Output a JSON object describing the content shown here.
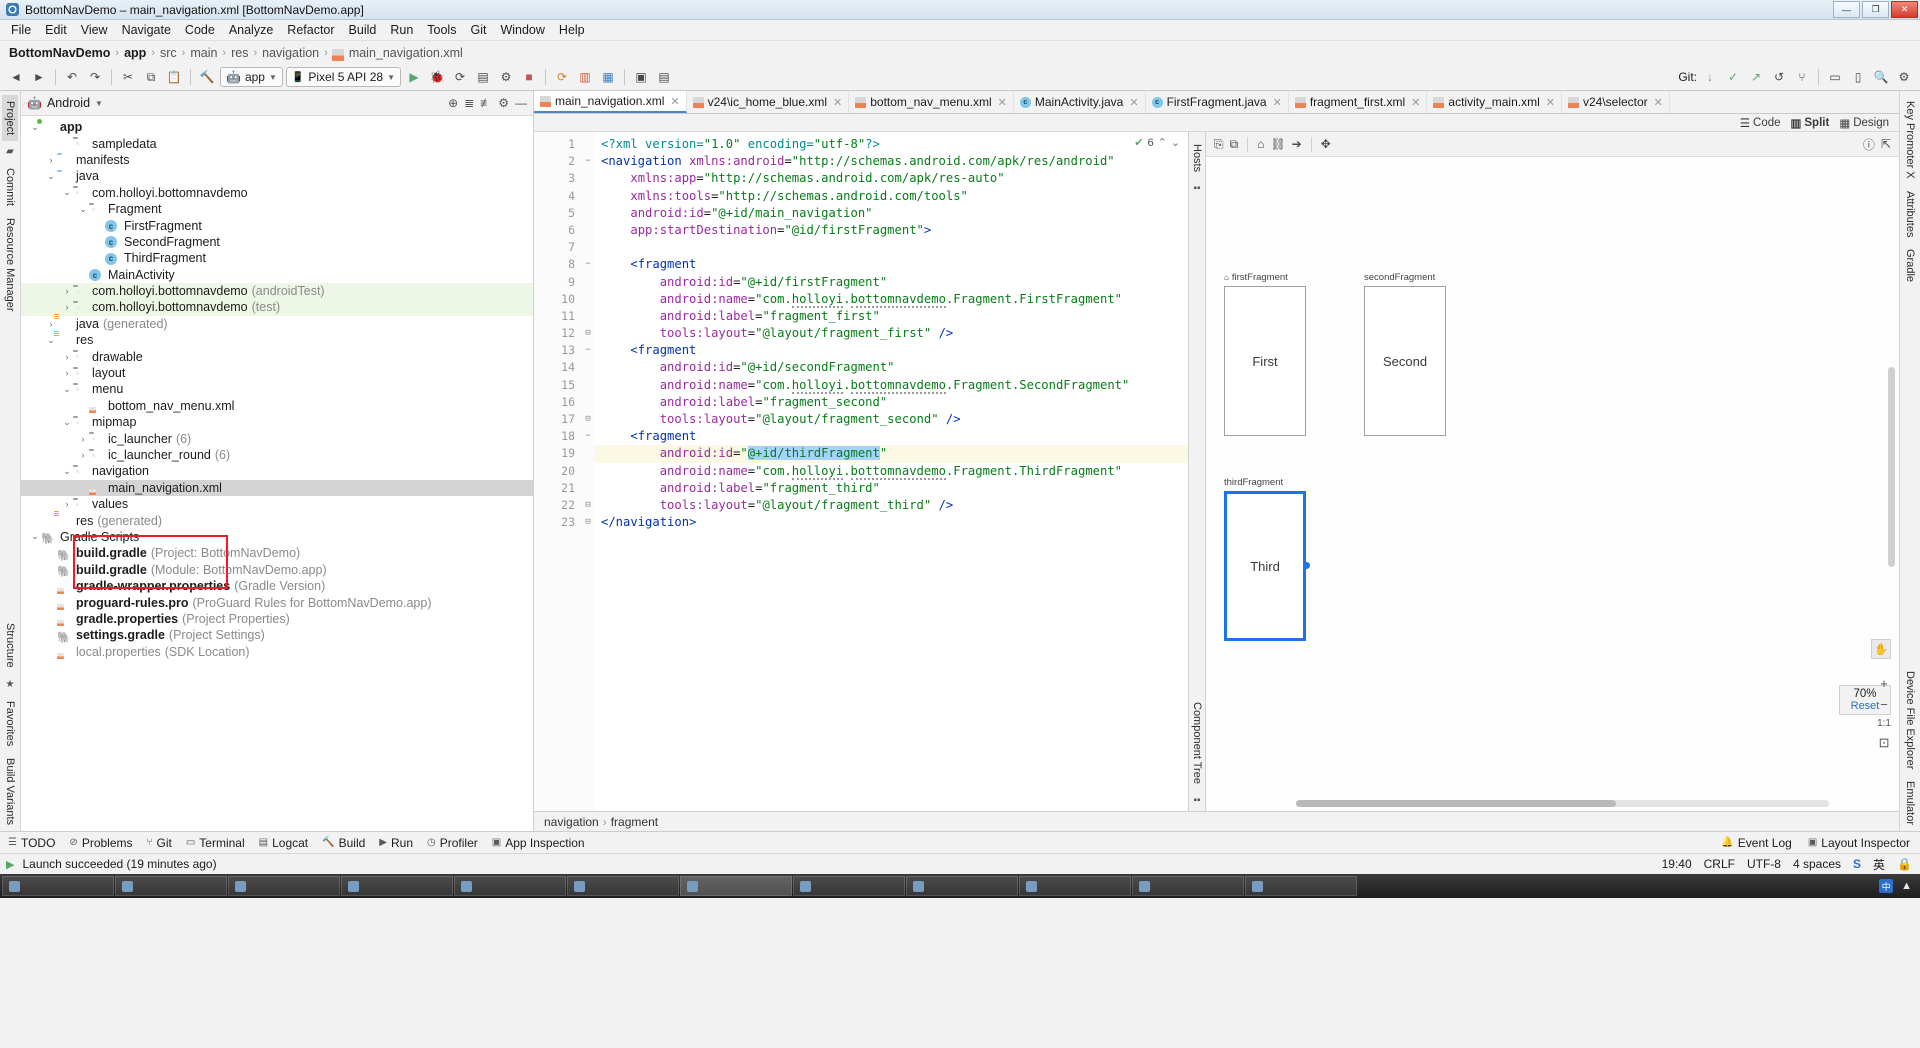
{
  "titlebar": {
    "title": "BottomNavDemo – main_navigation.xml [BottomNavDemo.app]",
    "app_initial": "AS",
    "minimize": "—",
    "maximize": "❐",
    "close": "✕"
  },
  "menubar": {
    "items": [
      "File",
      "Edit",
      "View",
      "Navigate",
      "Code",
      "Analyze",
      "Refactor",
      "Build",
      "Run",
      "Tools",
      "Git",
      "Window",
      "Help"
    ]
  },
  "breadcrumb": {
    "items": [
      "BottomNavDemo",
      "app",
      "src",
      "main",
      "res",
      "navigation",
      "main_navigation.xml"
    ]
  },
  "toolbar": {
    "run_config": "app",
    "device": "Pixel 5 API 28",
    "git_label": "Git:",
    "icons": [
      "hammer-icon",
      "sync-icon",
      "run-icon",
      "debug-icon",
      "profile-icon",
      "stop-icon",
      "avd-icon",
      "sdk-icon",
      "layout-inspector-icon",
      "search-icon",
      "settings-icon"
    ]
  },
  "project": {
    "header_label": "Android",
    "tree": [
      {
        "depth": 0,
        "arrow": "v",
        "icon": "f-mod",
        "label": "app",
        "bold": true,
        "suffix": ""
      },
      {
        "depth": 2,
        "arrow": "",
        "icon": "f-gray",
        "label": "sampledata",
        "bold": false,
        "suffix": ""
      },
      {
        "depth": 1,
        "arrow": ">",
        "icon": "f-blue",
        "label": "manifests",
        "bold": false,
        "suffix": ""
      },
      {
        "depth": 1,
        "arrow": "v",
        "icon": "f-blue",
        "label": "java",
        "bold": false,
        "suffix": ""
      },
      {
        "depth": 2,
        "arrow": "v",
        "icon": "f-gray",
        "label": "com.holloyi.bottomnavdemo",
        "bold": false,
        "suffix": ""
      },
      {
        "depth": 3,
        "arrow": "v",
        "icon": "f-gray",
        "label": "Fragment",
        "bold": false,
        "suffix": ""
      },
      {
        "depth": 4,
        "arrow": "",
        "icon": "c-cls",
        "label": "FirstFragment",
        "bold": false,
        "suffix": ""
      },
      {
        "depth": 4,
        "arrow": "",
        "icon": "c-cls",
        "label": "SecondFragment",
        "bold": false,
        "suffix": ""
      },
      {
        "depth": 4,
        "arrow": "",
        "icon": "c-cls",
        "label": "ThirdFragment",
        "bold": false,
        "suffix": ""
      },
      {
        "depth": 3,
        "arrow": "",
        "icon": "c-cls",
        "label": "MainActivity",
        "bold": false,
        "suffix": ""
      },
      {
        "depth": 2,
        "arrow": ">",
        "icon": "f-gray",
        "label": "com.holloyi.bottomnavdemo",
        "bold": false,
        "suffix": "(androidTest)",
        "row": "test"
      },
      {
        "depth": 2,
        "arrow": ">",
        "icon": "f-gray",
        "label": "com.holloyi.bottomnavdemo",
        "bold": false,
        "suffix": "(test)",
        "row": "test"
      },
      {
        "depth": 1,
        "arrow": ">",
        "icon": "f-res",
        "label": "java",
        "bold": false,
        "suffix": "(generated)"
      },
      {
        "depth": 1,
        "arrow": "v",
        "icon": "f-res",
        "label": "res",
        "bold": false,
        "suffix": ""
      },
      {
        "depth": 2,
        "arrow": ">",
        "icon": "f-gray",
        "label": "drawable",
        "bold": false,
        "suffix": ""
      },
      {
        "depth": 2,
        "arrow": ">",
        "icon": "f-gray",
        "label": "layout",
        "bold": false,
        "suffix": ""
      },
      {
        "depth": 2,
        "arrow": "v",
        "icon": "f-gray",
        "label": "menu",
        "bold": false,
        "suffix": ""
      },
      {
        "depth": 3,
        "arrow": "",
        "icon": "x-xml",
        "label": "bottom_nav_menu.xml",
        "bold": false,
        "suffix": ""
      },
      {
        "depth": 2,
        "arrow": "v",
        "icon": "f-gray",
        "label": "mipmap",
        "bold": false,
        "suffix": ""
      },
      {
        "depth": 3,
        "arrow": ">",
        "icon": "f-gray",
        "label": "ic_launcher",
        "bold": false,
        "suffix": "(6)"
      },
      {
        "depth": 3,
        "arrow": ">",
        "icon": "f-gray",
        "label": "ic_launcher_round",
        "bold": false,
        "suffix": "(6)"
      },
      {
        "depth": 2,
        "arrow": "v",
        "icon": "f-gray",
        "label": "navigation",
        "bold": false,
        "suffix": ""
      },
      {
        "depth": 3,
        "arrow": "",
        "icon": "x-xml",
        "label": "main_navigation.xml",
        "bold": false,
        "suffix": "",
        "row": "sel"
      },
      {
        "depth": 2,
        "arrow": ">",
        "icon": "f-gray",
        "label": "values",
        "bold": false,
        "suffix": ""
      },
      {
        "depth": 1,
        "arrow": "",
        "icon": "f-res",
        "label": "res",
        "bold": false,
        "suffix": "(generated)"
      },
      {
        "depth": 0,
        "arrow": "v",
        "icon": "g-grd",
        "label": "Gradle Scripts",
        "bold": false,
        "suffix": ""
      },
      {
        "depth": 1,
        "arrow": "",
        "icon": "g-grd",
        "label": "build.gradle",
        "bold": true,
        "suffix": "(Project: BottomNavDemo)"
      },
      {
        "depth": 1,
        "arrow": "",
        "icon": "g-grd",
        "label": "build.gradle",
        "bold": true,
        "suffix": "(Module: BottomNavDemo.app)"
      },
      {
        "depth": 1,
        "arrow": "",
        "icon": "x-xml",
        "label": "gradle-wrapper.properties",
        "bold": true,
        "suffix": "(Gradle Version)"
      },
      {
        "depth": 1,
        "arrow": "",
        "icon": "x-xml",
        "label": "proguard-rules.pro",
        "bold": true,
        "suffix": "(ProGuard Rules for BottomNavDemo.app)"
      },
      {
        "depth": 1,
        "arrow": "",
        "icon": "x-xml",
        "label": "gradle.properties",
        "bold": true,
        "suffix": "(Project Properties)"
      },
      {
        "depth": 1,
        "arrow": "",
        "icon": "g-grd",
        "label": "settings.gradle",
        "bold": true,
        "suffix": "(Project Settings)"
      },
      {
        "depth": 1,
        "arrow": "",
        "icon": "x-xml",
        "label": "local.properties",
        "bold": false,
        "suffix": "(SDK Location)",
        "dim": true
      }
    ]
  },
  "left_rail": {
    "tabs": [
      "Project",
      "Commit",
      "Resource Manager"
    ]
  },
  "right_rail": {
    "tabs": [
      "Key Promoter X",
      "Attributes",
      "Gradle",
      "Device File Explorer",
      "Emulator"
    ]
  },
  "bottom_rail": {
    "tabs": [
      "Structure",
      "Favorites",
      "Build Variants"
    ]
  },
  "editor_tabs": [
    {
      "label": "main_navigation.xml",
      "icon": "xml-icon",
      "active": true
    },
    {
      "label": "v24\\ic_home_blue.xml",
      "icon": "xml-icon",
      "active": false
    },
    {
      "label": "bottom_nav_menu.xml",
      "icon": "xml-icon",
      "active": false
    },
    {
      "label": "MainActivity.java",
      "icon": "java-icon",
      "active": false
    },
    {
      "label": "FirstFragment.java",
      "icon": "java-icon",
      "active": false
    },
    {
      "label": "fragment_first.xml",
      "icon": "xml-icon",
      "active": false
    },
    {
      "label": "activity_main.xml",
      "icon": "xml-icon",
      "active": false
    },
    {
      "label": "v24\\selector",
      "icon": "xml-icon",
      "active": false
    }
  ],
  "mode_bar": {
    "code": "Code",
    "split": "Split",
    "design": "Design"
  },
  "code": {
    "inspection_count": "6",
    "lines": [
      {
        "n": 1,
        "fold": "",
        "html": "<span class=\"pi\">&lt;?xml version=</span><span class=\"v\">\"1.0\"</span><span class=\"pi\"> encoding=</span><span class=\"v\">\"utf-8\"</span><span class=\"pi\">?&gt;</span>"
      },
      {
        "n": 2,
        "fold": "−",
        "html": "<span class=\"k\">&lt;navigation </span><span class=\"at\">xmlns:android</span><span class=\"eq\">=</span><span class=\"v\">\"http://schemas.android.com/apk/res/android\"</span>"
      },
      {
        "n": 3,
        "fold": "",
        "html": "    <span class=\"at\">xmlns:app</span><span class=\"eq\">=</span><span class=\"v\">\"http://schemas.android.com/apk/res-auto\"</span>"
      },
      {
        "n": 4,
        "fold": "",
        "html": "    <span class=\"at\">xmlns:tools</span><span class=\"eq\">=</span><span class=\"v\">\"http://schemas.android.com/tools\"</span>"
      },
      {
        "n": 5,
        "fold": "",
        "html": "    <span class=\"at\">android:id</span><span class=\"eq\">=</span><span class=\"v\">\"@+id/main_navigation\"</span>"
      },
      {
        "n": 6,
        "fold": "",
        "html": "    <span class=\"at\">app:startDestination</span><span class=\"eq\">=</span><span class=\"v\">\"@id/firstFragment\"</span><span class=\"k\">&gt;</span>"
      },
      {
        "n": 7,
        "fold": "",
        "html": ""
      },
      {
        "n": 8,
        "fold": "−",
        "html": "    <span class=\"k\">&lt;fragment</span>"
      },
      {
        "n": 9,
        "fold": "",
        "html": "        <span class=\"at\">android:id</span><span class=\"eq\">=</span><span class=\"v\">\"@+id/firstFragment\"</span>"
      },
      {
        "n": 10,
        "fold": "",
        "html": "        <span class=\"at\">android:name</span><span class=\"eq\">=</span><span class=\"v\">\"com.<span class=\"squig\">holloyi</span>.<span class=\"squig\">bottomnavdemo</span>.Fragment.FirstFragment\"</span>"
      },
      {
        "n": 11,
        "fold": "",
        "html": "        <span class=\"at\">android:label</span><span class=\"eq\">=</span><span class=\"v\">\"fragment_first\"</span>"
      },
      {
        "n": 12,
        "fold": "⊟",
        "html": "        <span class=\"at\">tools:layout</span><span class=\"eq\">=</span><span class=\"v\">\"@layout/fragment_first\"</span> <span class=\"k\">/&gt;</span>"
      },
      {
        "n": 13,
        "fold": "−",
        "html": "    <span class=\"k\">&lt;fragment</span>"
      },
      {
        "n": 14,
        "fold": "",
        "html": "        <span class=\"at\">android:id</span><span class=\"eq\">=</span><span class=\"v\">\"@+id/secondFragment\"</span>"
      },
      {
        "n": 15,
        "fold": "",
        "html": "        <span class=\"at\">android:name</span><span class=\"eq\">=</span><span class=\"v\">\"com.<span class=\"squig\">holloyi</span>.<span class=\"squig\">bottomnavdemo</span>.Fragment.SecondFragment\"</span>"
      },
      {
        "n": 16,
        "fold": "",
        "html": "        <span class=\"at\">android:label</span><span class=\"eq\">=</span><span class=\"v\">\"fragment_second\"</span>"
      },
      {
        "n": 17,
        "fold": "⊟",
        "html": "        <span class=\"at\">tools:layout</span><span class=\"eq\">=</span><span class=\"v\">\"@layout/fragment_second\"</span> <span class=\"k\">/&gt;</span>"
      },
      {
        "n": 18,
        "fold": "−",
        "html": "    <span class=\"k\">&lt;fragment</span>"
      },
      {
        "n": 19,
        "fold": "",
        "hl": true,
        "html": "        <span class=\"at\">android:id</span><span class=\"eq\">=</span><span class=\"v\">\"<span class=\"sel-txt\">@+id/thirdFragment</span>\"</span>"
      },
      {
        "n": 20,
        "fold": "",
        "html": "        <span class=\"at\">android:name</span><span class=\"eq\">=</span><span class=\"v\">\"com.<span class=\"squig\">holloyi</span>.<span class=\"squig\">bottomnavdemo</span>.Fragment.ThirdFragment\"</span>"
      },
      {
        "n": 21,
        "fold": "",
        "html": "        <span class=\"at\">android:label</span><span class=\"eq\">=</span><span class=\"v\">\"fragment_third\"</span>"
      },
      {
        "n": 22,
        "fold": "⊟",
        "html": "        <span class=\"at\">tools:layout</span><span class=\"eq\">=</span><span class=\"v\">\"@layout/fragment_third\"</span> <span class=\"k\">/&gt;</span>"
      },
      {
        "n": 23,
        "fold": "⊟",
        "html": "<span class=\"k\">&lt;/navigation&gt;</span>"
      }
    ]
  },
  "design": {
    "hosts_label": "Hosts",
    "component_tree_label": "Component Tree",
    "destinations": [
      {
        "label": "firstFragment",
        "text": "First",
        "home": true,
        "selected": false
      },
      {
        "label": "secondFragment",
        "text": "Second",
        "home": false,
        "selected": false
      },
      {
        "label": "thirdFragment",
        "text": "Third",
        "home": false,
        "selected": true
      }
    ],
    "zoom_percent": "70%",
    "zoom_reset": "Reset",
    "zoom_in": "+",
    "zoom_out": "−",
    "zoom_actual": "1:1",
    "zoom_fit": "⊡",
    "breadcrumb": [
      "navigation",
      "fragment"
    ]
  },
  "tool_window_bar": {
    "left": [
      "TODO",
      "Problems",
      "Git",
      "Terminal",
      "Logcat",
      "Build",
      "Run",
      "Profiler",
      "App Inspection"
    ],
    "right": [
      "Event Log",
      "Layout Inspector"
    ]
  },
  "statusbar": {
    "message": "Launch succeeded (19 minutes ago)",
    "time": "19:40",
    "line_sep": "CRLF",
    "encoding": "UTF-8",
    "indent": "4 spaces",
    "ime": "英",
    "lock": "lock-icon"
  },
  "taskbar": {
    "items": [
      {
        "label": "",
        "active": false
      },
      {
        "label": "",
        "active": false
      },
      {
        "label": "",
        "active": false
      },
      {
        "label": "",
        "active": false
      },
      {
        "label": "",
        "active": false
      },
      {
        "label": "",
        "active": false
      },
      {
        "label": "",
        "active": true
      },
      {
        "label": "",
        "active": false
      },
      {
        "label": "",
        "active": false
      },
      {
        "label": "",
        "active": false
      },
      {
        "label": "",
        "active": false
      },
      {
        "label": "",
        "active": false
      }
    ]
  }
}
